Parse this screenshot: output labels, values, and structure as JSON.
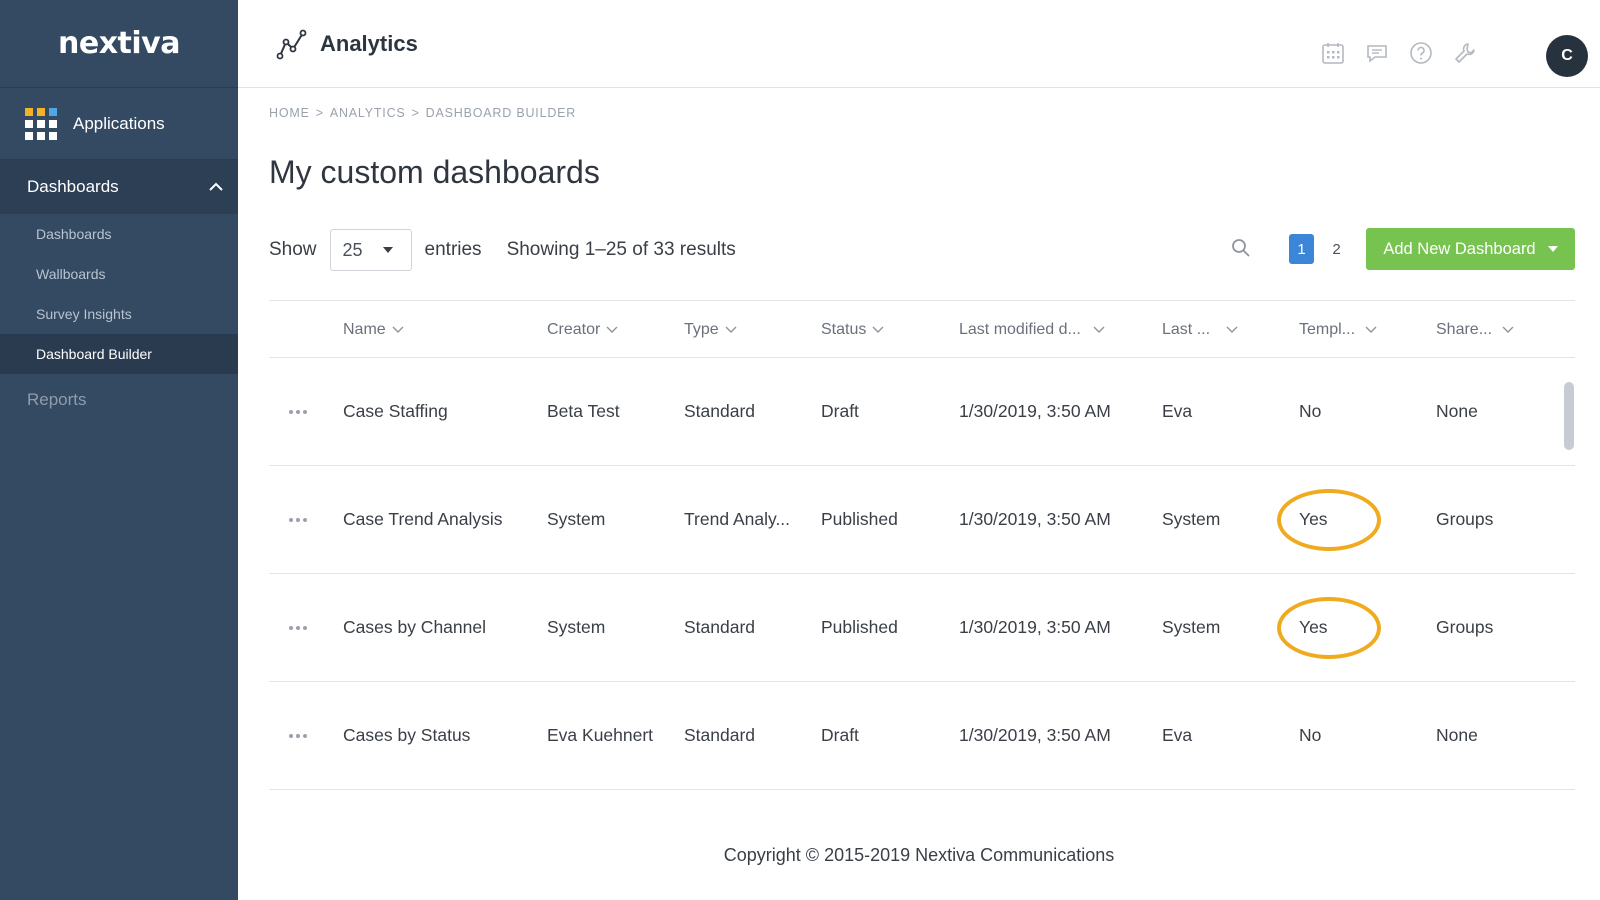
{
  "sidebar": {
    "logo": "nextiva",
    "applications_label": "Applications",
    "section_label": "Dashboards",
    "items": [
      {
        "label": "Dashboards",
        "active": false
      },
      {
        "label": "Wallboards",
        "active": false
      },
      {
        "label": "Survey Insights",
        "active": false
      },
      {
        "label": "Dashboard Builder",
        "active": true
      }
    ],
    "reports_label": "Reports"
  },
  "header": {
    "app_title": "Analytics",
    "icons": [
      "calendar-icon",
      "chat-icon",
      "help-icon",
      "wrench-icon"
    ],
    "avatar_initial": "C"
  },
  "breadcrumb": [
    "HOME",
    ">",
    "ANALYTICS",
    ">",
    "DASHBOARD BUILDER"
  ],
  "page_title": "My custom dashboards",
  "controls": {
    "show_label": "Show",
    "entries_value": "25",
    "entries_label": "entries",
    "results_text": "Showing 1–25 of 33 results",
    "pages": [
      "1",
      "2"
    ],
    "current_page": "1",
    "add_button_label": "Add New Dashboard"
  },
  "table": {
    "columns": [
      "Name",
      "Creator",
      "Type",
      "Status",
      "Last modified d...",
      "Last ...",
      "Templ...",
      "Share..."
    ],
    "rows": [
      [
        "Case Staffing",
        "Beta Test",
        "Standard",
        "Draft",
        "1/30/2019, 3:50 AM",
        "Eva",
        "No",
        "None"
      ],
      [
        "Case Trend Analysis",
        "System",
        "Trend Analy...",
        "Published",
        "1/30/2019, 3:50 AM",
        "System",
        "Yes",
        "Groups"
      ],
      [
        "Cases by Channel",
        "System",
        "Standard",
        "Published",
        "1/30/2019, 3:50 AM",
        "System",
        "Yes",
        "Groups"
      ],
      [
        "Cases by Status",
        "Eva Kuehnert",
        "Standard",
        "Draft",
        "1/30/2019, 3:50 AM",
        "Eva",
        "No",
        "None"
      ]
    ],
    "highlighted_rows": [
      1,
      2
    ]
  },
  "footer": "Copyright © 2015-2019 Nextiva Communications",
  "colors": {
    "sidebar_bg": "#344a63",
    "accent_green": "#77c350",
    "page_active": "#3b86d6",
    "highlight_ring": "#f0aa1e"
  }
}
